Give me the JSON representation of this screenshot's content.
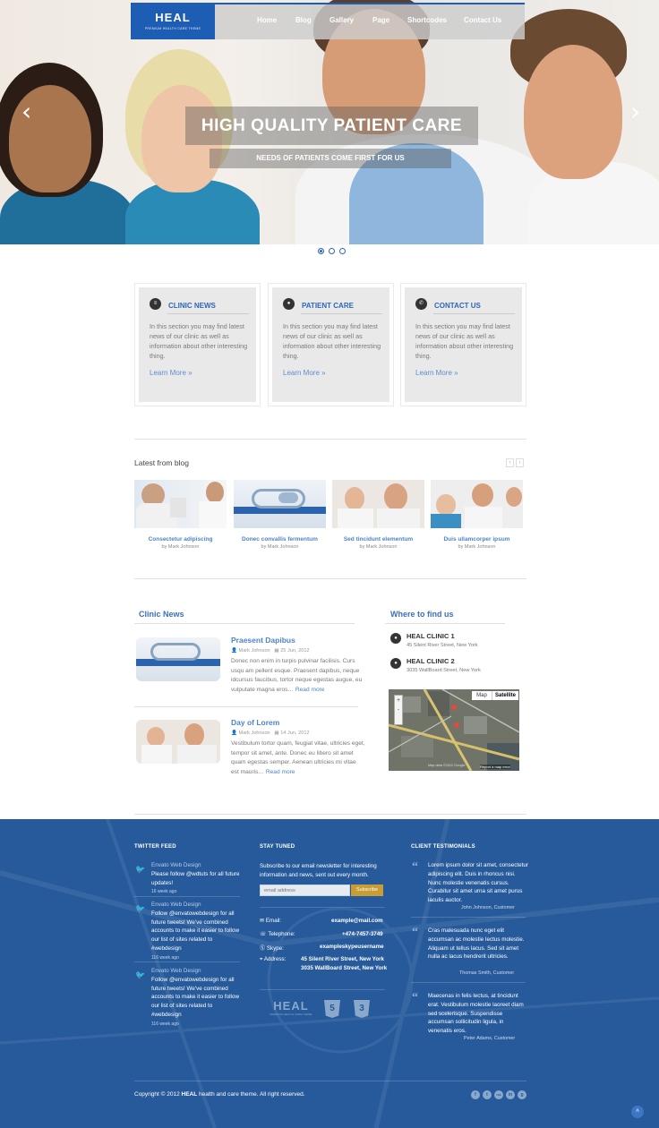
{
  "brand": {
    "name": "HEAL",
    "tagline": "PREMIUM HEALTH CARE THEME"
  },
  "nav": {
    "items": [
      "Home",
      "Blog",
      "Gallery",
      "Page",
      "Shortcodes",
      "Contact Us"
    ]
  },
  "hero": {
    "title": "HIGH QUALITY PATIENT CARE",
    "subtitle": "NEEDS OF PATIENTS COME FIRST FOR US",
    "prev_icon": "chevron-left-icon",
    "next_icon": "chevron-right-icon",
    "slides_count": 3,
    "active_slide": 1
  },
  "features": [
    {
      "title": "CLINIC NEWS",
      "icon": "news-icon",
      "text": "In this section you may find latest news of our clinic as well as information about other interesting thing.",
      "link": "Learn More »"
    },
    {
      "title": "PATIENT CARE",
      "icon": "chat-icon",
      "text": "In this section you may find latest news of our clinic as well as information about other interesting thing.",
      "link": "Learn More »"
    },
    {
      "title": "CONTACT US",
      "icon": "phone-icon",
      "text": "In this section you may find latest news of our clinic as well as information about other interesting thing.",
      "link": "Learn More »"
    }
  ],
  "blog": {
    "heading": "Latest from blog",
    "posts": [
      {
        "title": "Consectetur adipiscing",
        "author": "by Mark Johnson"
      },
      {
        "title": "Donec convallis fermentum",
        "author": "by Mark Johnson"
      },
      {
        "title": "Sed tincidunt elementum",
        "author": "by Mark Johnson"
      },
      {
        "title": "Duis ullamcorper ipsum",
        "author": "by Mark Johnson"
      }
    ]
  },
  "clinic_news": {
    "heading": "Clinic News",
    "items": [
      {
        "title": "Praesent Dapibus",
        "author": "Mark Johnson",
        "date": "25 Jun, 2012",
        "text": "Donec non enim in turpis pulvinar facilisis. Curs usqu am pellent esque. Praesent dapibus, neque idcursus faucibus, tortor neque egestas augue, eu vulputate magna eros…",
        "more": "Read more"
      },
      {
        "title": "Day of Lorem",
        "author": "Mark Johnson",
        "date": "14 Jun, 2012",
        "text": "Vestibulum tortor quam, feugiat vitae, ultricies eget, tempor sit amet, ante. Donec eu libero sit amet quam egestas semper. Aenean ultricies mi vitae est mauris…",
        "more": "Read more"
      }
    ]
  },
  "locations": {
    "heading": "Where to find us",
    "items": [
      {
        "name": "HEAL CLINIC 1",
        "address": "45 Silent River Street, New York"
      },
      {
        "name": "HEAL CLINIC 2",
        "address": "3035 WallBoard Street, New York"
      }
    ],
    "map_tabs": [
      "Map",
      "Satellite"
    ],
    "map_footer": "Map data ©2012 Google",
    "map_report": "Report a map error"
  },
  "footer": {
    "twitter": {
      "heading": "TWITTER FEED",
      "tweets": [
        {
          "name": "Envato Web Design",
          "text": "Please follow @wdtuts for all future updates!",
          "ago": "16 week ago"
        },
        {
          "name": "Envato Web Design",
          "text": "Follow @envatowebdesign for all future tweets! We've combined accounts to make it easier to follow our list of sites related to #webdesign",
          "ago": "116 week ago"
        },
        {
          "name": "Envato Web Design",
          "text": "Follow @envatowebdesign for all future tweets! We've combined accounts to make it easier to follow our list of sites related to #webdesign",
          "ago": "116 week ago"
        }
      ]
    },
    "newsletter": {
      "heading": "STAY TUNED",
      "text": "Subscribe to our email newsletter for interesting information and news, sent out every month.",
      "placeholder": "email address",
      "button": "Subscribe"
    },
    "contact": {
      "email_label": "Email:",
      "email": "example@mail.com",
      "phone_label": "Telephone:",
      "phone": "+474-7457-3749",
      "skype_label": "Skype:",
      "skype": "exampleskypeusername",
      "address_label": "Address:",
      "address1": "45 Silent River Street, New York",
      "address2": "3035 WallBoard Street, New York"
    },
    "badges": {
      "logo": "HEAL",
      "logo_tagline": "PREMIUM HEALTH CARE THEME",
      "html5": "5",
      "css3": "3"
    },
    "testimonials": {
      "heading": "CLIENT TESTIMONIALS",
      "items": [
        {
          "text": "Lorem ipsum dolor sit amet, consectetur adipiscing elit. Duis in rhoncus nisi. Nunc molestie venenatis cursus. Curabitur sit amet urna sit amet purus iaculis auctor.",
          "author": "John Johnson, Customer"
        },
        {
          "text": "Cras malesuada nunc eget elit accumsan ac molestie lectus molestie. Aliquam ut tellus lacus. Sed sit amet nulla ac lacus hendrerit ultricies.",
          "author": "Thomas Smith, Customer"
        },
        {
          "text": "Maecenas in felis lectus, at tincidunt erat. Vestibulum molestie laoreet diam sed scelerisque. Suspendisse accumsan sollicitudin ligula, in venenatis eros.",
          "author": "Peter Adams, Customer"
        }
      ]
    },
    "copyright_pre": "Copyright © 2012 ",
    "copyright_brand": "HEAL",
    "copyright_post": " health and care theme. All right reserved.",
    "social": [
      "f",
      "t",
      "rss",
      "in",
      "g"
    ]
  },
  "colors": {
    "accent": "#1e5db4",
    "link": "#4e83c8",
    "footer_bg": "#265a9a"
  }
}
